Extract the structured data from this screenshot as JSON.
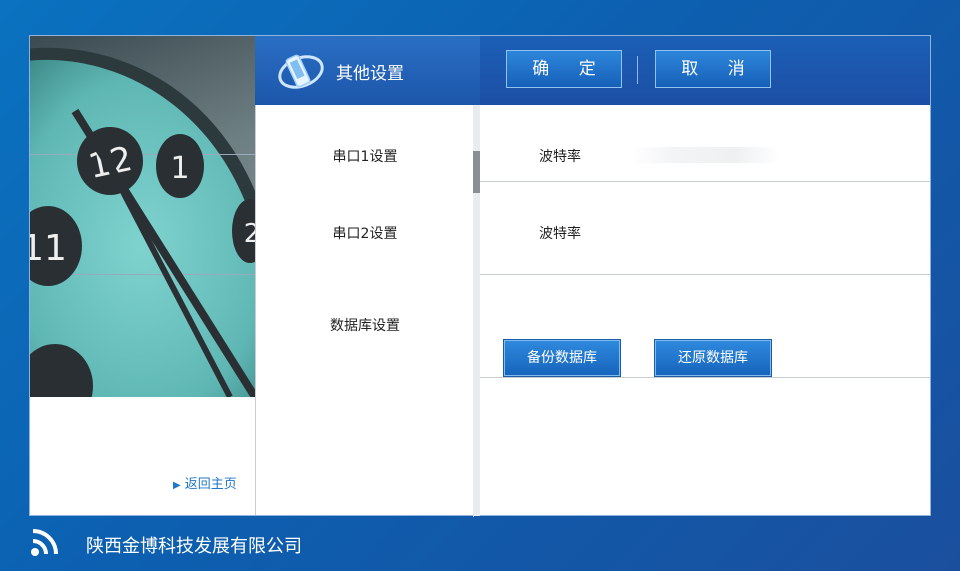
{
  "header": {
    "title": "其他设置",
    "confirm_label": "确 定",
    "cancel_label": "取 消"
  },
  "menu": {
    "items": [
      {
        "label": "串口1设置"
      },
      {
        "label": "串口2设置"
      },
      {
        "label": "数据库设置"
      }
    ]
  },
  "settings": {
    "serial1": {
      "label": "波特率",
      "value": ""
    },
    "serial2": {
      "label": "波特率",
      "value": ""
    },
    "database": {
      "backup_label": "备份数据库",
      "restore_label": "还原数据库"
    }
  },
  "sidebar": {
    "back_label": "返回主页",
    "clock_numbers": [
      "12",
      "1",
      "2",
      "11"
    ]
  },
  "footer": {
    "company": "陕西金博科技发展有限公司"
  },
  "colors": {
    "background": "#0d5fb0",
    "header": "#1c4fa5",
    "button": "#1660b8",
    "link": "#1f77c8"
  },
  "icons": {
    "header": "phone-orbit-icon",
    "footer": "wireless-signal-icon",
    "back": "triangle-right-icon"
  }
}
